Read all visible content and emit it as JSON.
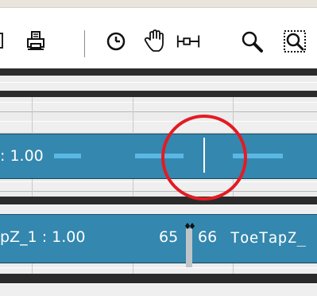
{
  "toolbar": {
    "icons": [
      "print-icon",
      "clock-icon",
      "hand-pan-icon",
      "fit-frame-icon",
      "zoom-icon",
      "zoom-region-icon"
    ]
  },
  "tracks": {
    "upper": {
      "label": ": 1.00"
    },
    "lower": {
      "label_left": "pZ_1 : 1.00",
      "frame_left": "65",
      "frame_right": "66",
      "label_right": "ToeTapZ_"
    }
  },
  "colors": {
    "track_fill": "#3487ae",
    "track_dash": "#5ab8e3",
    "highlight": "#e31b23",
    "dark_band": "#2b2b2b",
    "boundary": "#bfc4c8"
  }
}
